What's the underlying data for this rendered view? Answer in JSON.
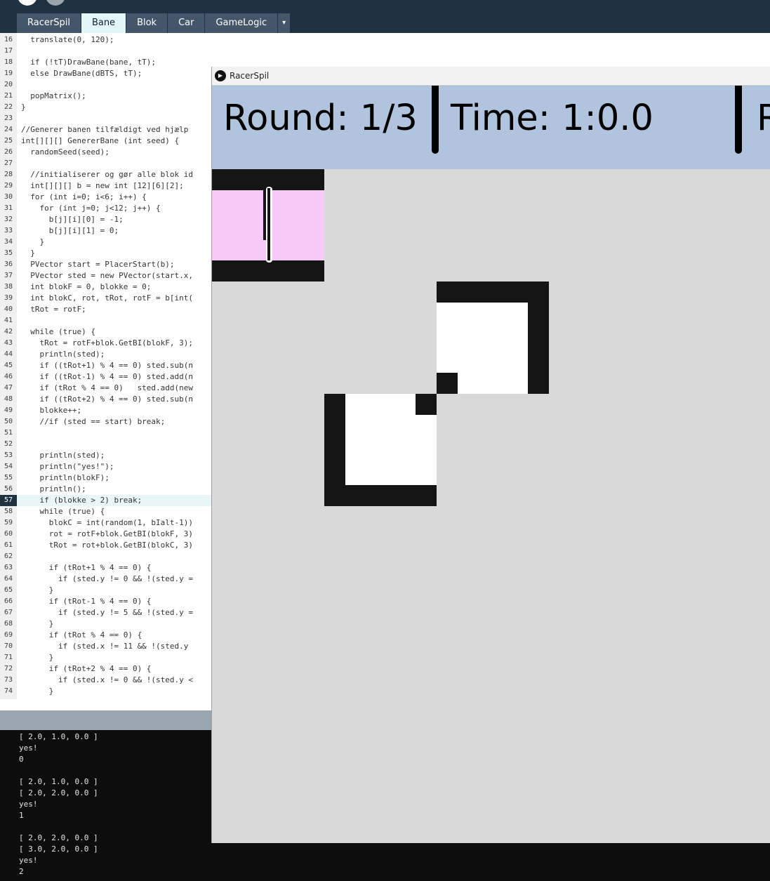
{
  "editor": {
    "tabs": [
      "RacerSpil",
      "Bane",
      "Blok",
      "Car",
      "GameLogic"
    ],
    "active_tab": "Bane",
    "more_tabs_icon": "▾",
    "highlighted_line": 57,
    "lines": [
      {
        "n": "16",
        "text": "  translate(0, 120);"
      },
      {
        "n": "17",
        "text": ""
      },
      {
        "n": "18",
        "text": "  if (!tT)DrawBane(bane, tT);"
      },
      {
        "n": "19",
        "text": "  else DrawBane(dBTS, tT);"
      },
      {
        "n": "20",
        "text": ""
      },
      {
        "n": "21",
        "text": "  popMatrix();"
      },
      {
        "n": "22",
        "text": "}"
      },
      {
        "n": "23",
        "text": ""
      },
      {
        "n": "24",
        "text": "//Generer banen tilfældigt ved hjælp"
      },
      {
        "n": "25",
        "text": "int[][][] GenererBane (int seed) {"
      },
      {
        "n": "26",
        "text": "  randomSeed(seed);"
      },
      {
        "n": "27",
        "text": ""
      },
      {
        "n": "28",
        "text": "  //initialiserer og gør alle blok id"
      },
      {
        "n": "29",
        "text": "  int[][][] b = new int [12][6][2];"
      },
      {
        "n": "30",
        "text": "  for (int i=0; i<6; i++) {"
      },
      {
        "n": "31",
        "text": "    for (int j=0; j<12; j++) {"
      },
      {
        "n": "32",
        "text": "      b[j][i][0] = -1;"
      },
      {
        "n": "33",
        "text": "      b[j][i][1] = 0;"
      },
      {
        "n": "34",
        "text": "    }"
      },
      {
        "n": "35",
        "text": "  }"
      },
      {
        "n": "36",
        "text": "  PVector start = PlacerStart(b);"
      },
      {
        "n": "37",
        "text": "  PVector sted = new PVector(start.x,"
      },
      {
        "n": "38",
        "text": "  int blokF = 0, blokke = 0;"
      },
      {
        "n": "39",
        "text": "  int blokC, rot, tRot, rotF = b[int("
      },
      {
        "n": "40",
        "text": "  tRot = rotF;"
      },
      {
        "n": "41",
        "text": ""
      },
      {
        "n": "42",
        "text": "  while (true) {"
      },
      {
        "n": "43",
        "text": "    tRot = rotF+blok.GetBI(blokF, 3);"
      },
      {
        "n": "44",
        "text": "    println(sted);"
      },
      {
        "n": "45",
        "text": "    if ((tRot+1) % 4 == 0) sted.sub(n"
      },
      {
        "n": "46",
        "text": "    if ((tRot-1) % 4 == 0) sted.add(n"
      },
      {
        "n": "47",
        "text": "    if (tRot % 4 == 0)   sted.add(new"
      },
      {
        "n": "48",
        "text": "    if ((tRot+2) % 4 == 0) sted.sub(n"
      },
      {
        "n": "49",
        "text": "    blokke++;"
      },
      {
        "n": "50",
        "text": "    //if (sted == start) break;"
      },
      {
        "n": "51",
        "text": ""
      },
      {
        "n": "52",
        "text": ""
      },
      {
        "n": "53",
        "text": "    println(sted);"
      },
      {
        "n": "54",
        "text": "    println(\"yes!\");"
      },
      {
        "n": "55",
        "text": "    println(blokF);"
      },
      {
        "n": "56",
        "text": "    println();"
      },
      {
        "n": "57",
        "text": "    if (blokke > 2) break;"
      },
      {
        "n": "58",
        "text": "    while (true) {"
      },
      {
        "n": "59",
        "text": "      blokC = int(random(1, bIalt-1))"
      },
      {
        "n": "60",
        "text": "      rot = rotF+blok.GetBI(blokF, 3)"
      },
      {
        "n": "61",
        "text": "      tRot = rot+blok.GetBI(blokC, 3)"
      },
      {
        "n": "62",
        "text": ""
      },
      {
        "n": "63",
        "text": "      if (tRot+1 % 4 == 0) {"
      },
      {
        "n": "64",
        "text": "        if (sted.y != 0 && !(sted.y ="
      },
      {
        "n": "65",
        "text": "      }"
      },
      {
        "n": "66",
        "text": "      if (tRot-1 % 4 == 0) {"
      },
      {
        "n": "67",
        "text": "        if (sted.y != 5 && !(sted.y ="
      },
      {
        "n": "68",
        "text": "      }"
      },
      {
        "n": "69",
        "text": "      if (tRot % 4 == 0) {"
      },
      {
        "n": "70",
        "text": "        if (sted.x != 11 && !(sted.y"
      },
      {
        "n": "71",
        "text": "      }"
      },
      {
        "n": "72",
        "text": "      if (tRot+2 % 4 == 0) {"
      },
      {
        "n": "73",
        "text": "        if (sted.x != 0 && !(sted.y <"
      },
      {
        "n": "74",
        "text": "      }"
      }
    ]
  },
  "console": {
    "lines": [
      "[ 2.0, 1.0, 0.0 ]",
      "yes!",
      "0",
      "",
      "[ 2.0, 1.0, 0.0 ]",
      "[ 2.0, 2.0, 0.0 ]",
      "yes!",
      "1",
      "",
      "[ 2.0, 2.0, 0.0 ]",
      "[ 3.0, 2.0, 0.0 ]",
      "yes!",
      "2"
    ]
  },
  "sketch": {
    "title": "RacerSpil",
    "round": "Round: 1/3",
    "time": "Time: 1:0.0",
    "hud_cut_text": "R",
    "colors": {
      "hud_bg": "#b0c4de",
      "game_bg": "#d9d9d9",
      "track_black": "#151515",
      "track_white": "#ffffff",
      "start_pink": "#f7c9f7"
    }
  }
}
